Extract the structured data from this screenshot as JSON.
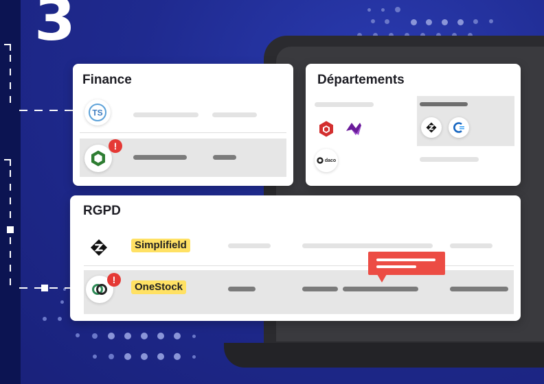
{
  "step_number": "3",
  "finance_card": {
    "title": "Finance",
    "rows": [
      {
        "logo": "ts-logo-icon",
        "alert": false
      },
      {
        "logo": "green-hexagon-logo-icon",
        "alert": true,
        "alert_mark": "!"
      }
    ]
  },
  "departements_card": {
    "title": "Départements",
    "logos": [
      "red-cube-logo-icon",
      "purple-chevron-logo-icon",
      "daco-logo-icon",
      "black-knot-logo-icon",
      "blue-c-logo-icon"
    ],
    "daco_label": "daco"
  },
  "rgpd_card": {
    "title": "RGPD",
    "rows": [
      {
        "logo": "simplifield-logo-icon",
        "tag": "Simplifield",
        "alert": false
      },
      {
        "logo": "onestock-logo-icon",
        "tag": "OneStock",
        "alert": true,
        "alert_mark": "!"
      }
    ]
  },
  "colors": {
    "background": "#1f2a8f",
    "alert": "#e53935",
    "tag": "#ffe164",
    "bubble": "#ec4c44",
    "row_highlight": "#e6e6e6"
  }
}
